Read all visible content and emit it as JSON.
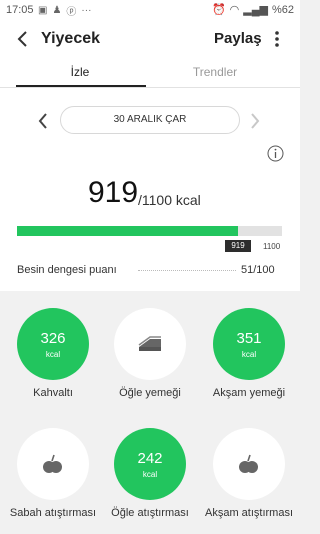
{
  "status": {
    "time": "17:05",
    "battery": "%62"
  },
  "header": {
    "title": "Yiyecek",
    "share_label": "Paylaş"
  },
  "tabs": [
    {
      "label": "İzle",
      "active": true
    },
    {
      "label": "Trendler",
      "active": false
    }
  ],
  "date": "30 ARALIK ÇAR",
  "calories": {
    "consumed": "919",
    "target_text": "/1100 kcal",
    "progress_fraction": 0.835,
    "badge": "919",
    "max_label": "1100"
  },
  "balance": {
    "label": "Besin dengesi puanı",
    "value": "51/100"
  },
  "meals": [
    {
      "name": "Kahvaltı",
      "value": "326",
      "unit": "kcal",
      "logged": true,
      "icon": "plate-icon"
    },
    {
      "name": "Öğle yemeği",
      "value": "",
      "unit": "",
      "logged": false,
      "icon": "sandwich-icon"
    },
    {
      "name": "Akşam yemeği",
      "value": "351",
      "unit": "kcal",
      "logged": true,
      "icon": "plate-icon"
    },
    {
      "name": "Sabah atıştırması",
      "value": "",
      "unit": "",
      "logged": false,
      "icon": "apple-icon"
    },
    {
      "name": "Öğle atıştırması",
      "value": "242",
      "unit": "kcal",
      "logged": true,
      "icon": "apple-icon"
    },
    {
      "name": "Akşam atıştırması",
      "value": "",
      "unit": "",
      "logged": false,
      "icon": "apple-icon"
    }
  ],
  "colors": {
    "accent": "#22c55e",
    "track": "#e2e2e2",
    "badge": "#2d2d2d"
  }
}
